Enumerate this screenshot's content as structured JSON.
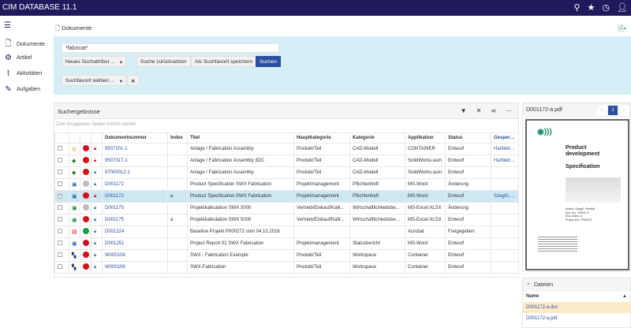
{
  "app": {
    "title": "CIM DATABASE 11.1"
  },
  "topbar_icons": [
    "search-icon",
    "star-icon",
    "clock-icon",
    "user-icon"
  ],
  "sidebar": {
    "items": [
      {
        "label": "Dokumente",
        "icon": "document-icon"
      },
      {
        "label": "Artikel",
        "icon": "gear-icon"
      },
      {
        "label": "Aktivitäten",
        "icon": "activity-icon"
      },
      {
        "label": "Aufgaben",
        "icon": "edit-icon"
      }
    ]
  },
  "breadcrumb": "Dokumente",
  "search": {
    "value": "*fabricat*",
    "new_attr": "Neues Suchattribut ...",
    "reset": "Suche zurücksetzen",
    "save_fav": "Als Suchfavorit speichern",
    "search": "Suchen",
    "fav_select": "Suchfavorit wählen ..."
  },
  "results": {
    "title": "Suchergebnisse",
    "group_hint": "Zum Gruppieren Spalte hierhin ziehen.",
    "columns": [
      "Dokumentnummer",
      "Index",
      "Titel",
      "Hauptkategorie",
      "Kategorie",
      "Applikation",
      "Status",
      "Gesperrt von"
    ],
    "rows": [
      {
        "checked": false,
        "type": "assembly",
        "dot": "#d0131b",
        "lock": "#c0122b",
        "nr": "9507201-1",
        "idx": "",
        "title": "Anlage / Fabrication Assembly",
        "haupt": "Produkt/Teil",
        "kat": "CAD-Modell",
        "app": "CONTAINER",
        "status": "Entwurf",
        "locked": "Hartlieb, M"
      },
      {
        "checked": false,
        "type": "solidworks",
        "dot": "#d0131b",
        "lock": "#c0122b",
        "nr": "9507317-1",
        "idx": "",
        "title": "Anlage / Fabrication Assembly 3DC",
        "haupt": "Produkt/Teil",
        "kat": "CAD-Modell",
        "app": "SolidWorks:asm",
        "status": "Entwurf",
        "locked": "Hartlieb, M"
      },
      {
        "checked": false,
        "type": "solidworks",
        "dot": "#d0131b",
        "lock": "#2b7fb8",
        "nr": "97000012-1",
        "idx": "",
        "title": "Anlage / Fabrication Assembly",
        "haupt": "Produkt/Teil",
        "kat": "CAD-Modell",
        "app": "SolidWorks:asm",
        "status": "Entwurf",
        "locked": ""
      },
      {
        "checked": false,
        "type": "word",
        "dot": "#bbbbbb",
        "lock": "#2b7fb8",
        "nr": "D001172",
        "idx": "",
        "title": "Product Specification SWX Fabrication",
        "haupt": "Projektmanagement",
        "kat": "Pflichtenheft",
        "app": "MS-Word",
        "status": "Änderung",
        "locked": ""
      },
      {
        "checked": true,
        "type": "word",
        "dot": "#d0131b",
        "lock": "#c0122b",
        "nr": "D001172",
        "idx": "a",
        "title": "Product Specification SWX Fabrication",
        "haupt": "Projektmanagement",
        "kat": "Pflichtenheft",
        "app": "MS-Word",
        "status": "Entwurf",
        "locked": "Szegfü, Ran"
      },
      {
        "checked": false,
        "type": "excel",
        "dot": "#bbbbbb",
        "lock": "#2b7fb8",
        "nr": "D001175",
        "idx": "",
        "title": "Projektkalkulation SWX 5000",
        "haupt": "Vertrieb/Einkauf/Kalk...",
        "kat": "Wirtschaftlichkeitsbe...",
        "app": "MS-Excel:XLSX",
        "status": "Änderung",
        "locked": ""
      },
      {
        "checked": false,
        "type": "excel",
        "dot": "#d0131b",
        "lock": "#2b7fb8",
        "nr": "D001175",
        "idx": "a",
        "title": "Projektkalkulation SWX 5000",
        "haupt": "Vertrieb/Einkauf/Kalk...",
        "kat": "Wirtschaftlichkeitsbe...",
        "app": "MS-Excel:XLSX",
        "status": "Entwurf",
        "locked": ""
      },
      {
        "checked": false,
        "type": "pdf",
        "dot": "#1a9a4a",
        "lock": "#2b7fb8",
        "nr": "D001224",
        "idx": "",
        "title": "Baseline Projekt P000272 vom 04.10.2016",
        "haupt": "",
        "kat": "",
        "app": "Acrobat",
        "status": "Freigegeben",
        "locked": ""
      },
      {
        "checked": false,
        "type": "word",
        "dot": "#d0131b",
        "lock": "#2b7fb8",
        "nr": "D001251",
        "idx": "",
        "title": "Project Report 01 SWX Fabrication",
        "haupt": "Projektmanagement",
        "kat": "Statusbericht",
        "app": "MS-Word",
        "status": "Entwurf",
        "locked": ""
      },
      {
        "checked": false,
        "type": "workspace",
        "dot": "#d0131b",
        "lock": "#2b7fb8",
        "nr": "W000108",
        "idx": "",
        "title": "SWX - Fabrication Example",
        "haupt": "Produkt/Teil",
        "kat": "Workspace",
        "app": "Container",
        "status": "Entwurf",
        "locked": ""
      },
      {
        "checked": false,
        "type": "workspace",
        "dot": "#d0131b",
        "lock": "#2b7fb8",
        "nr": "W000109",
        "idx": "",
        "title": "SWX-Fabrication",
        "haupt": "Produkt/Teil",
        "kat": "Workspace",
        "app": "Container",
        "status": "Entwurf",
        "locked": ""
      }
    ]
  },
  "preview": {
    "filename": "D001172-a.pdf",
    "page": "1",
    "prev": "‹",
    "next": "›",
    "doc_title": "Product development",
    "doc_subtitle": "Specification",
    "doc_meta": [
      "Author:  Szegfü, Randolf",
      "Doc.-No.:  D001172",
      "Doc.-Index:  a",
      "Project-No.:  P000272"
    ]
  },
  "files": {
    "title": "Dateien",
    "column": "Name",
    "items": [
      "D001172-a.doc",
      "D001172-a.pdf"
    ]
  }
}
